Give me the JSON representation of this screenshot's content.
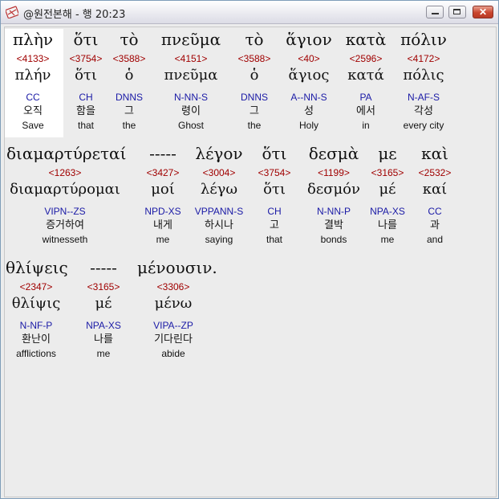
{
  "window": {
    "title": "@원전본해 - 행 20:23",
    "icon": "bible-app-icon",
    "controls": {
      "minimize": "minimize-icon",
      "maximize": "maximize-icon",
      "close": "✕"
    }
  },
  "rows": [
    {
      "words": [
        {
          "greek": "πλὴν",
          "strong": "<4133>",
          "lemma": "πλήν",
          "parse": "CC",
          "korean": "오직",
          "english": "Save"
        },
        {
          "greek": "ὅτι",
          "strong": "<3754>",
          "lemma": "ὅτι",
          "parse": "CH",
          "korean": "함을",
          "english": "that"
        },
        {
          "greek": "τὸ",
          "strong": "<3588>",
          "lemma": "ὁ",
          "parse": "DNNS",
          "korean": "그",
          "english": "the"
        },
        {
          "greek": "πνεῦμα",
          "strong": "<4151>",
          "lemma": "πνεῦμα",
          "parse": "N-NN-S",
          "korean": "령이",
          "english": "Ghost"
        },
        {
          "greek": "τὸ",
          "strong": "<3588>",
          "lemma": "ὁ",
          "parse": "DNNS",
          "korean": "그",
          "english": "the"
        },
        {
          "greek": "ἅγιον",
          "strong": "<40>",
          "lemma": "ἅγιος",
          "parse": "A--NN-S",
          "korean": "성",
          "english": "Holy"
        },
        {
          "greek": "κατὰ",
          "strong": "<2596>",
          "lemma": "κατά",
          "parse": "PA",
          "korean": "에서",
          "english": "in"
        },
        {
          "greek": "πόλιν",
          "strong": "<4172>",
          "lemma": "πόλις",
          "parse": "N-AF-S",
          "korean": "각성",
          "english": "every city"
        }
      ]
    },
    {
      "words": [
        {
          "greek": "διαμαρτύρεταί",
          "strong": "<1263>",
          "lemma": "διαμαρτύρομαι",
          "parse": "VIPN--ZS",
          "korean": "증거하여",
          "english": "witnesseth"
        },
        {
          "greek": "-----",
          "strong": "<3427>",
          "lemma": "μοί",
          "parse": "NPD-XS",
          "korean": "내게",
          "english": "me"
        },
        {
          "greek": "λέγον",
          "strong": "<3004>",
          "lemma": "λέγω",
          "parse": "VPPANN-S",
          "korean": "하시나",
          "english": "saying"
        },
        {
          "greek": "ὅτι",
          "strong": "<3754>",
          "lemma": "ὅτι",
          "parse": "CH",
          "korean": "고",
          "english": "that"
        },
        {
          "greek": "δεσμὰ",
          "strong": "<1199>",
          "lemma": "δεσμόν",
          "parse": "N-NN-P",
          "korean": "결박",
          "english": "bonds"
        },
        {
          "greek": "με",
          "strong": "<3165>",
          "lemma": "μέ",
          "parse": "NPA-XS",
          "korean": "나를",
          "english": "me"
        },
        {
          "greek": "καὶ",
          "strong": "<2532>",
          "lemma": "καί",
          "parse": "CC",
          "korean": "과",
          "english": "and"
        }
      ]
    },
    {
      "words": [
        {
          "greek": "θλίψεις",
          "strong": "<2347>",
          "lemma": "θλίψις",
          "parse": "N-NF-P",
          "korean": "환난이",
          "english": "afflictions"
        },
        {
          "greek": "-----",
          "strong": "<3165>",
          "lemma": "μέ",
          "parse": "NPA-XS",
          "korean": "나를",
          "english": "me"
        },
        {
          "greek": "μένουσιν.",
          "strong": "<3306>",
          "lemma": "μένω",
          "parse": "VIPA--ZP",
          "korean": "기다린다",
          "english": "abide"
        }
      ]
    }
  ]
}
